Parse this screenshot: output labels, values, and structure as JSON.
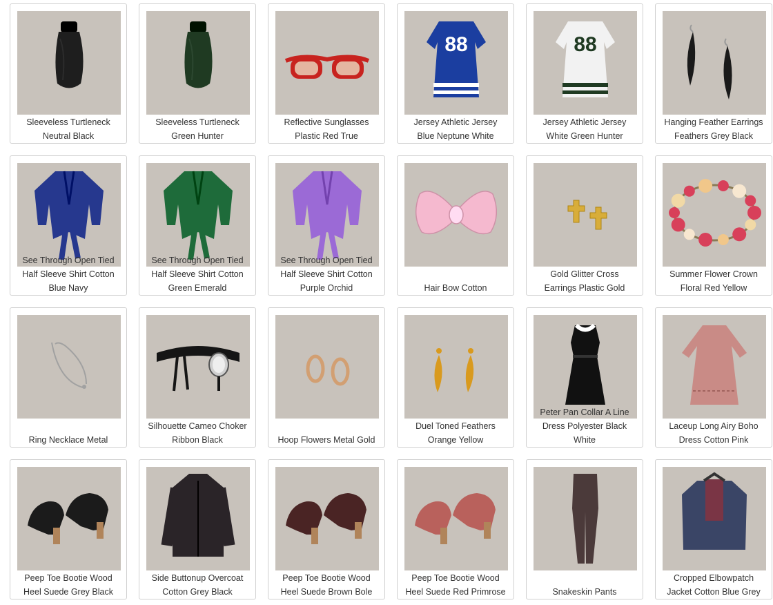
{
  "catalog": {
    "items": [
      {
        "lines": [
          "Sleeveless Turtleneck",
          "Neutral Black"
        ],
        "icon": "turtleneck-icon",
        "color": "#1e1e1e"
      },
      {
        "lines": [
          "Sleeveless Turtleneck",
          "Green Hunter"
        ],
        "icon": "turtleneck-icon",
        "color": "#1f3a22"
      },
      {
        "lines": [
          "Reflective Sunglasses",
          "Plastic Red True"
        ],
        "icon": "sunglasses-icon",
        "color": "#c8231f"
      },
      {
        "lines": [
          "Jersey Athletic Jersey",
          "Blue Neptune White"
        ],
        "icon": "jersey-dress-icon",
        "color": "#1b3ea0"
      },
      {
        "lines": [
          "Jersey Athletic Jersey",
          "White Green Hunter"
        ],
        "icon": "jersey-dress-icon",
        "color": "#f2f2f2"
      },
      {
        "lines": [
          "Hanging Feather Earrings",
          "Feathers Grey Black"
        ],
        "icon": "feather-earrings-icon",
        "color": "#1a1a1a"
      },
      {
        "lines": [
          "See Through Open Tied",
          "Half Sleeve Shirt Cotton",
          "Blue Navy"
        ],
        "icon": "tied-shirt-icon",
        "color": "#26388e"
      },
      {
        "lines": [
          "See Through Open Tied",
          "Half Sleeve Shirt Cotton",
          "Green Emerald"
        ],
        "icon": "tied-shirt-icon",
        "color": "#1e6b3a"
      },
      {
        "lines": [
          "See Through Open Tied",
          "Half Sleeve Shirt Cotton",
          "Purple Orchid"
        ],
        "icon": "tied-shirt-icon",
        "color": "#9b6ad6"
      },
      {
        "lines": [
          "Hair Bow Cotton"
        ],
        "icon": "hair-bow-icon",
        "color": "#f5b9cf"
      },
      {
        "lines": [
          "Gold Glitter Cross",
          "Earrings Plastic Gold"
        ],
        "icon": "cross-earrings-icon",
        "color": "#d8ad3a"
      },
      {
        "lines": [
          "Summer Flower Crown",
          "Floral Red Yellow"
        ],
        "icon": "flower-crown-icon",
        "color": "#d8405a"
      },
      {
        "lines": [
          "Ring Necklace Metal"
        ],
        "icon": "necklace-icon",
        "color": "#c9c9c9"
      },
      {
        "lines": [
          "Silhouette Cameo Choker",
          "Ribbon Black"
        ],
        "icon": "choker-icon",
        "color": "#151515"
      },
      {
        "lines": [
          "Hoop Flowers Metal Gold"
        ],
        "icon": "hoop-earrings-icon",
        "color": "#d29f72"
      },
      {
        "lines": [
          "Duel Toned Feathers",
          "Orange Yellow"
        ],
        "icon": "drop-earrings-icon",
        "color": "#d99a1e"
      },
      {
        "lines": [
          "Peter Pan Collar A Line",
          "Dress Polyester Black",
          "White"
        ],
        "icon": "dress-icon",
        "color": "#111111"
      },
      {
        "lines": [
          "Laceup Long Airy Boho",
          "Dress Cotton Pink"
        ],
        "icon": "boho-dress-icon",
        "color": "#c98b86"
      },
      {
        "lines": [
          "Peep Toe Bootie Wood",
          "Heel Suede Grey Black"
        ],
        "icon": "bootie-icon",
        "color": "#1b1b1b"
      },
      {
        "lines": [
          "Side Buttonup Overcoat",
          "Cotton Grey Black"
        ],
        "icon": "overcoat-icon",
        "color": "#2a2428"
      },
      {
        "lines": [
          "Peep Toe Bootie Wood",
          "Heel Suede Brown Bole"
        ],
        "icon": "bootie-icon",
        "color": "#4a2424"
      },
      {
        "lines": [
          "Peep Toe Bootie Wood",
          "Heel Suede Red Primrose"
        ],
        "icon": "bootie-icon",
        "color": "#b9615c"
      },
      {
        "lines": [
          "Snakeskin Pants"
        ],
        "icon": "pants-icon",
        "color": "#4b3a3a"
      },
      {
        "lines": [
          "Cropped Elbowpatch",
          "Jacket Cotton Blue Grey"
        ],
        "icon": "jacket-icon",
        "color": "#3a4566"
      }
    ]
  }
}
